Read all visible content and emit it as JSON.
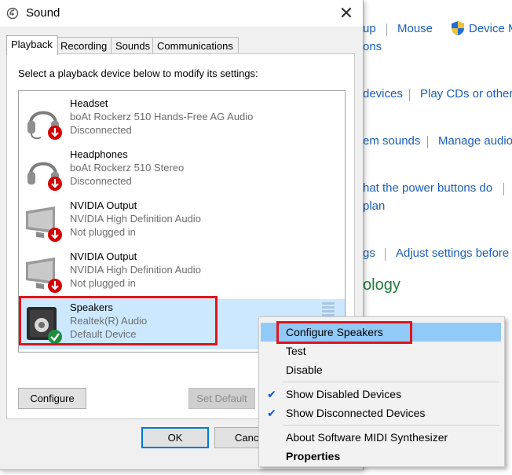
{
  "background": {
    "links": [
      {
        "text": "up",
        "color": "#1a5fb4"
      },
      {
        "text": "Mouse"
      },
      {
        "text": "Device M"
      },
      {
        "text": "ons"
      },
      {
        "text": "devices"
      },
      {
        "text": "Play CDs or other"
      },
      {
        "text": "em sounds"
      },
      {
        "text": "Manage audio"
      },
      {
        "text": "hat the power buttons do"
      },
      {
        "text": "plan"
      },
      {
        "text": "gs"
      },
      {
        "text": "Adjust settings before"
      }
    ],
    "heading": "ology",
    "heading_color": "#1f7a3a"
  },
  "dialog": {
    "title": "Sound",
    "close_label": "✕",
    "tabs": [
      {
        "label": "Playback",
        "active": true
      },
      {
        "label": "Recording"
      },
      {
        "label": "Sounds"
      },
      {
        "label": "Communications"
      }
    ],
    "instruction": "Select a playback device below to modify its settings:",
    "devices": [
      {
        "name": "Headset",
        "line1": "boAt Rockerz 510 Hands-Free AG Audio",
        "line2": "Disconnected",
        "icon": "headset-icon",
        "status": "down"
      },
      {
        "name": "Headphones",
        "line1": "boAt Rockerz 510 Stereo",
        "line2": "Disconnected",
        "icon": "headphones-icon",
        "status": "down"
      },
      {
        "name": "NVIDIA Output",
        "line1": "NVIDIA High Definition Audio",
        "line2": "Not plugged in",
        "icon": "monitor-icon",
        "status": "down"
      },
      {
        "name": "NVIDIA Output",
        "line1": "NVIDIA High Definition Audio",
        "line2": "Not plugged in",
        "icon": "monitor-icon",
        "status": "down"
      },
      {
        "name": "Speakers",
        "line1": "Realtek(R) Audio",
        "line2": "Default Device",
        "icon": "speaker-icon",
        "status": "default"
      }
    ],
    "buttons": {
      "configure": "Configure",
      "set_default": "Set Default",
      "ok": "OK",
      "cancel": "Cancel"
    },
    "selection_color": "#cce8ff",
    "highlight_color": "#e0141e"
  },
  "context_menu": {
    "items": [
      {
        "label": "Configure Speakers",
        "highlighted": true
      },
      {
        "label": "Test"
      },
      {
        "label": "Disable"
      },
      {
        "label": "Show Disabled Devices",
        "checked": true
      },
      {
        "label": "Show Disconnected Devices",
        "checked": true
      },
      {
        "label": "About Software MIDI Synthesizer"
      },
      {
        "label": "Properties",
        "bold": true
      }
    ],
    "check_glyph": "✔"
  }
}
